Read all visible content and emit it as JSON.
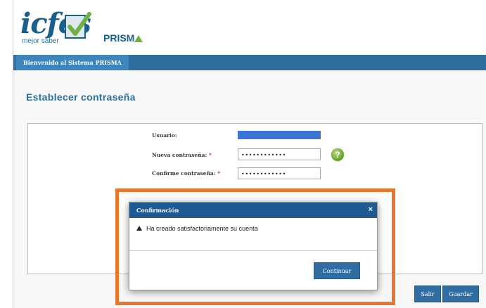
{
  "header": {
    "logo_text": "icfes",
    "logo_tagline": "mejor saber",
    "product_name": "PRISM",
    "product_icon": "triangle-icon"
  },
  "nav": {
    "tab_label": "Bienvenido al Sistema PRISMA"
  },
  "page": {
    "title": "Establecer contraseña"
  },
  "form": {
    "user_label": "Usuario:",
    "password_label": "Nueva contraseña:",
    "confirm_label": "Confirme contraseña:",
    "required_mark": "*",
    "password_value": "••••••••••••",
    "confirm_value": "••••••••••••",
    "help_icon_symbol": "?"
  },
  "actions": {
    "exit_label": "Salir",
    "save_label": "Guardar"
  },
  "dialog": {
    "title": "Confirmación",
    "close_symbol": "×",
    "message": "Ha creado satisfactoriamente su cuenta",
    "continue_label": "Continuar"
  },
  "colors": {
    "brand_blue": "#1f5b92",
    "highlight_orange": "#e6782c",
    "help_green": "#6fb143"
  }
}
